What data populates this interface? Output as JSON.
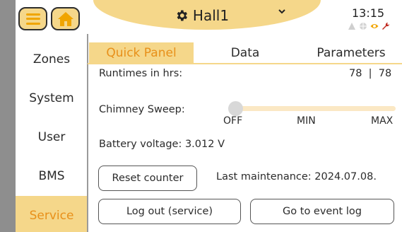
{
  "header": {
    "title": "Hall1",
    "time": "13:15",
    "icons": [
      "menu-icon",
      "home-icon",
      "gear-icon",
      "chevron-down-icon",
      "warning-icon",
      "globe-icon",
      "eye-icon",
      "wrench-icon"
    ]
  },
  "sidebar": {
    "items": [
      {
        "label": "Zones"
      },
      {
        "label": "System"
      },
      {
        "label": "User"
      },
      {
        "label": "BMS"
      },
      {
        "label": "Service"
      }
    ],
    "active": "Service"
  },
  "tabs": [
    {
      "label": "Quick Panel"
    },
    {
      "label": "Data"
    },
    {
      "label": "Parameters"
    }
  ],
  "quick_panel": {
    "runtimes_label": "Runtimes in hrs:",
    "runtimes_value": "78  |  78",
    "chimney_label": "Chimney Sweep:",
    "chimney_options": [
      "OFF",
      "MIN",
      "MAX"
    ],
    "chimney_selected": "OFF",
    "battery_text": "Battery voltage: 3.012 V",
    "reset_button": "Reset counter",
    "last_maintenance": "Last maintenance: 2024.07.08.",
    "logout_button": "Log out (service)",
    "event_log_button": "Go to event log"
  },
  "colors": {
    "accent": "#f5d78a",
    "active_text": "#e8901a",
    "track": "#fbe8c4"
  }
}
